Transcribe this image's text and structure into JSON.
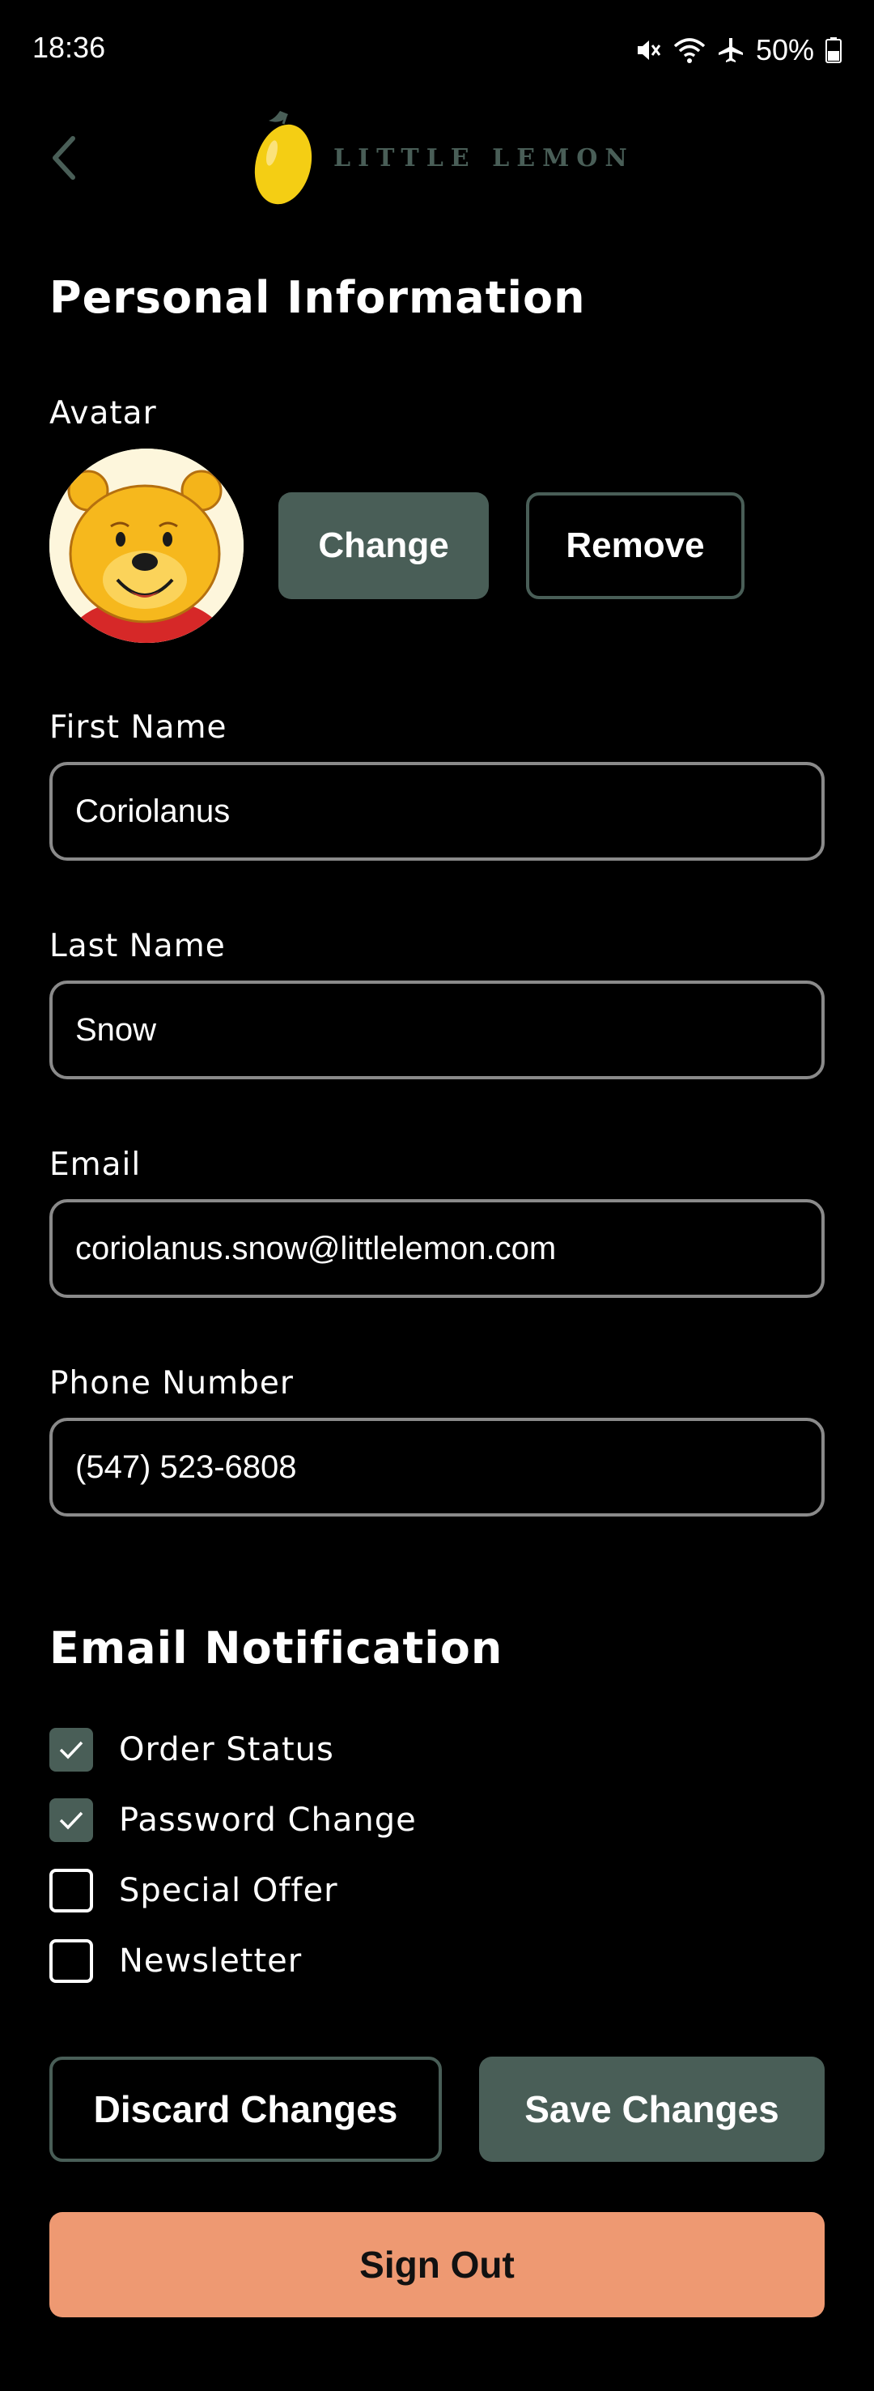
{
  "status_bar": {
    "time": "18:36",
    "battery": "50%",
    "icons": [
      "mute-icon",
      "wifi-icon",
      "airplane-icon",
      "battery-icon"
    ]
  },
  "header": {
    "back_icon": "chevron-left-icon",
    "logo_text": "LITTLE LEMON"
  },
  "profile": {
    "title": "Personal Information",
    "avatar_label": "Avatar",
    "change_label": "Change",
    "remove_label": "Remove",
    "fields": {
      "first_name": {
        "label": "First Name",
        "value": "Coriolanus"
      },
      "last_name": {
        "label": "Last Name",
        "value": "Snow"
      },
      "email": {
        "label": "Email",
        "value": "coriolanus.snow@littlelemon.com"
      },
      "phone": {
        "label": "Phone Number",
        "value": "(547) 523-6808"
      }
    }
  },
  "notifications": {
    "title": "Email Notification",
    "options": [
      {
        "label": "Order Status",
        "checked": true
      },
      {
        "label": "Password Change",
        "checked": true
      },
      {
        "label": "Special Offer",
        "checked": false
      },
      {
        "label": "Newsletter",
        "checked": false
      }
    ]
  },
  "actions": {
    "discard_label": "Discard Changes",
    "save_label": "Save Changes",
    "signout_label": "Sign Out"
  },
  "colors": {
    "background": "#000000",
    "primary_green": "#495e57",
    "signout_orange": "#ee9972",
    "input_border": "#8a8a8a"
  }
}
